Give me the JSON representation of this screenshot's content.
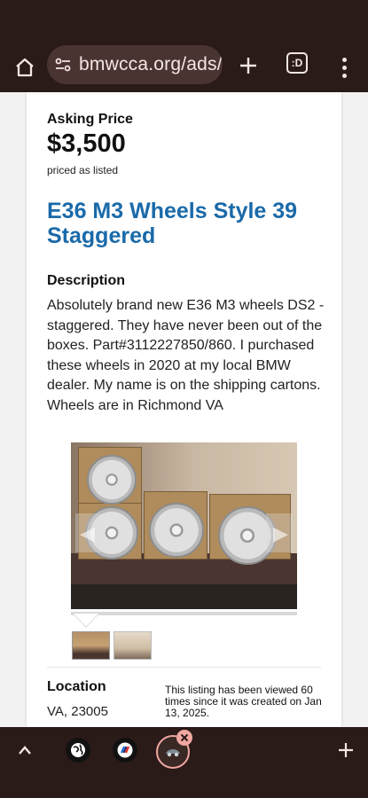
{
  "browser": {
    "url": "bmwcca.org/ads/",
    "tab_count_label": ":D"
  },
  "listing": {
    "price_label": "Asking Price",
    "price": "$3,500",
    "price_note": "priced as listed",
    "title": "E36 M3 Wheels Style 39 Staggered",
    "description_label": "Description",
    "description": "Absolutely brand new E36 M3 wheels DS2 - staggered. They have never been out of the boxes. Part#3112227850/860. I purchased these wheels in 2020 at my local BMW dealer. My name is on the shipping cartons. Wheels are in Richmond VA",
    "location_label": "Location",
    "location": "VA, 23005",
    "views_note": "This listing has been viewed 60 times since it was created on Jan 13, 2025."
  },
  "gallery": {
    "thumbnail_count": 2,
    "active_index": 0
  },
  "colors": {
    "title_blue": "#1a6aa9",
    "browser_chrome": "#2a1a18",
    "accent_pink": "#f0a7a0"
  }
}
